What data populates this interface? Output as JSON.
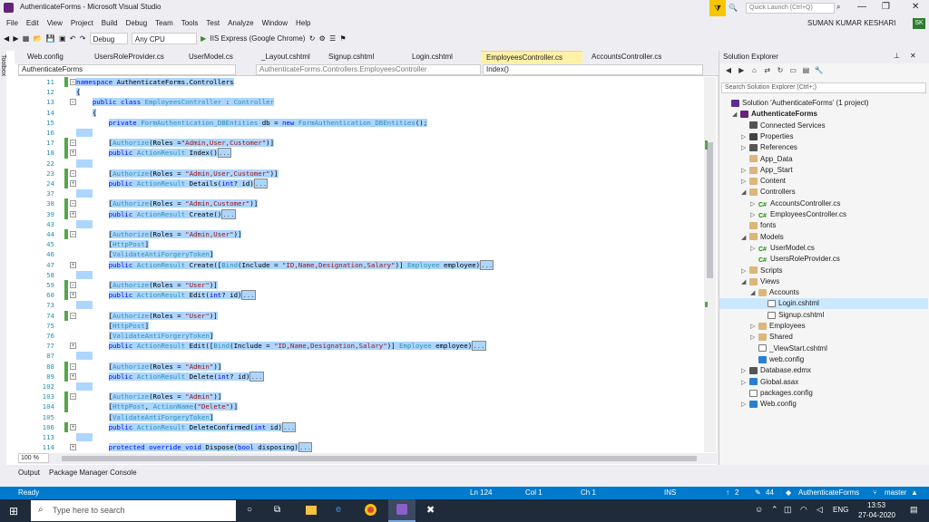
{
  "window": {
    "title": "AuthenticateForms - Microsoft Visual Studio",
    "quick_launch_placeholder": "Quick Launch (Ctrl+Q)",
    "user": "SUMAN KUMAR KESHARI",
    "user_initials": "SK"
  },
  "menu": [
    "File",
    "Edit",
    "View",
    "Project",
    "Build",
    "Debug",
    "Team",
    "Tools",
    "Test",
    "Analyze",
    "Window",
    "Help"
  ],
  "toolbar": {
    "config": "Debug",
    "platform": "Any CPU",
    "run_label": "IIS Express (Google Chrome)"
  },
  "tabs": [
    "Web.config",
    "UsersRoleProvider.cs",
    "UserModel.cs",
    "_Layout.cshtml",
    "Signup.cshtml",
    "Login.cshtml",
    "EmployeesController.cs",
    "AccountsController.cs"
  ],
  "active_tab": "EmployeesController.cs",
  "nav": {
    "project": "AuthenticateForms",
    "class": "AuthenticateForms.Controllers.EmployeesController",
    "member": "Index()"
  },
  "side_tool": "Toolbox",
  "code_lines": [
    {
      "n": "11",
      "t": "namespace AuthenticateForms.Controllers",
      "g": true
    },
    {
      "n": "12",
      "t": "{",
      "g": false
    },
    {
      "n": "13",
      "t": "    public class EmployeesController : Controller",
      "g": false
    },
    {
      "n": "14",
      "t": "    {",
      "g": false
    },
    {
      "n": "15",
      "t": "        private FormAuthentication_DBEntities db = new FormAuthentication_DBEntities();",
      "g": false
    },
    {
      "n": "16",
      "t": "",
      "g": false
    },
    {
      "n": "17",
      "t": "        [Authorize(Roles =\"Admin,User,Customer\")]",
      "g": true
    },
    {
      "n": "18",
      "t": "        public ActionResult Index()[...]",
      "g": true
    },
    {
      "n": "22",
      "t": "",
      "g": false
    },
    {
      "n": "23",
      "t": "        [Authorize(Roles = \"Admin,User,Customer\")]",
      "g": true
    },
    {
      "n": "24",
      "t": "        public ActionResult Details(int? id)[...]",
      "g": true
    },
    {
      "n": "37",
      "t": "",
      "g": false
    },
    {
      "n": "38",
      "t": "        [Authorize(Roles = \"Admin,Customer\")]",
      "g": true
    },
    {
      "n": "39",
      "t": "        public ActionResult Create()[...]",
      "g": true
    },
    {
      "n": "43",
      "t": "",
      "g": false
    },
    {
      "n": "44",
      "t": "        [Authorize(Roles = \"Admin,User\")]",
      "g": true
    },
    {
      "n": "45",
      "t": "        [HttpPost]",
      "g": false
    },
    {
      "n": "46",
      "t": "        [ValidateAntiForgeryToken]",
      "g": false
    },
    {
      "n": "47",
      "t": "        public ActionResult Create([Bind(Include = \"ID,Name,Designation,Salary\")] Employee employee)[...]",
      "g": false
    },
    {
      "n": "58",
      "t": "",
      "g": false
    },
    {
      "n": "59",
      "t": "        [Authorize(Roles = \"User\")]",
      "g": true
    },
    {
      "n": "60",
      "t": "        public ActionResult Edit(int? id)[...]",
      "g": true
    },
    {
      "n": "73",
      "t": "",
      "g": false
    },
    {
      "n": "74",
      "t": "        [Authorize(Roles = \"User\")]",
      "g": true
    },
    {
      "n": "75",
      "t": "        [HttpPost]",
      "g": false
    },
    {
      "n": "76",
      "t": "        [ValidateAntiForgeryToken]",
      "g": false
    },
    {
      "n": "77",
      "t": "        public ActionResult Edit([Bind(Include = \"ID,Name,Designation,Salary\")] Employee employee)[...]",
      "g": false
    },
    {
      "n": "87",
      "t": "",
      "g": false
    },
    {
      "n": "88",
      "t": "        [Authorize(Roles = \"Admin\")]",
      "g": true
    },
    {
      "n": "89",
      "t": "        public ActionResult Delete(int? id)[...]",
      "g": true
    },
    {
      "n": "102",
      "t": "",
      "g": false
    },
    {
      "n": "103",
      "t": "        [Authorize(Roles = \"Admin\")]",
      "g": true
    },
    {
      "n": "104",
      "t": "        [HttpPost, ActionName(\"Delete\")]",
      "g": true
    },
    {
      "n": "105",
      "t": "        [ValidateAntiForgeryToken]",
      "g": false
    },
    {
      "n": "106",
      "t": "        public ActionResult DeleteConfirmed(int id)[...]",
      "g": true
    },
    {
      "n": "113",
      "t": "",
      "g": false
    },
    {
      "n": "114",
      "t": "        protected override void Dispose(bool disposing)[...]",
      "g": false
    }
  ],
  "zoom": "100 %",
  "bottom_tabs": [
    "Output",
    "Package Manager Console"
  ],
  "status": {
    "ready": "Ready",
    "ln": "Ln 124",
    "col": "Col 1",
    "ch": "Ch 1",
    "ins": "INS",
    "up": "2",
    "edits": "44",
    "project": "AuthenticateForms",
    "branch": "master"
  },
  "solution_explorer": {
    "title": "Solution Explorer",
    "search_placeholder": "Search Solution Explorer (Ctrl+;)",
    "items": [
      {
        "label": "Solution 'AuthenticateForms' (1 project)",
        "icon": "sol",
        "depth": 0,
        "arrow": ""
      },
      {
        "label": "AuthenticateForms",
        "icon": "proj",
        "depth": 1,
        "arrow": "◢",
        "bold": true
      },
      {
        "label": "Connected Services",
        "icon": "ref",
        "depth": 2,
        "arrow": ""
      },
      {
        "label": "Properties",
        "icon": "wrench",
        "depth": 2,
        "arrow": "▷"
      },
      {
        "label": "References",
        "icon": "ref",
        "depth": 2,
        "arrow": "▷"
      },
      {
        "label": "App_Data",
        "icon": "folder",
        "depth": 2,
        "arrow": ""
      },
      {
        "label": "App_Start",
        "icon": "folder",
        "depth": 2,
        "arrow": "▷"
      },
      {
        "label": "Content",
        "icon": "folder",
        "depth": 2,
        "arrow": "▷"
      },
      {
        "label": "Controllers",
        "icon": "folder",
        "depth": 2,
        "arrow": "◢"
      },
      {
        "label": "AccountsController.cs",
        "icon": "cs",
        "depth": 3,
        "arrow": "▷"
      },
      {
        "label": "EmployeesController.cs",
        "icon": "cs",
        "depth": 3,
        "arrow": "▷"
      },
      {
        "label": "fonts",
        "icon": "folder",
        "depth": 2,
        "arrow": ""
      },
      {
        "label": "Models",
        "icon": "folder",
        "depth": 2,
        "arrow": "◢"
      },
      {
        "label": "UserModel.cs",
        "icon": "cs",
        "depth": 3,
        "arrow": "▷"
      },
      {
        "label": "UsersRoleProvider.cs",
        "icon": "cs",
        "depth": 3,
        "arrow": ""
      },
      {
        "label": "Scripts",
        "icon": "folder",
        "depth": 2,
        "arrow": "▷"
      },
      {
        "label": "Views",
        "icon": "folder",
        "depth": 2,
        "arrow": "◢"
      },
      {
        "label": "Accounts",
        "icon": "folder",
        "depth": 3,
        "arrow": "◢"
      },
      {
        "label": "Login.cshtml",
        "icon": "file",
        "depth": 4,
        "arrow": "",
        "selected": true
      },
      {
        "label": "Signup.cshtml",
        "icon": "file",
        "depth": 4,
        "arrow": ""
      },
      {
        "label": "Employees",
        "icon": "folder",
        "depth": 3,
        "arrow": "▷"
      },
      {
        "label": "Shared",
        "icon": "folder",
        "depth": 3,
        "arrow": "▷"
      },
      {
        "label": "_ViewStart.cshtml",
        "icon": "file",
        "depth": 3,
        "arrow": ""
      },
      {
        "label": "web.config",
        "icon": "web",
        "depth": 3,
        "arrow": ""
      },
      {
        "label": "Database.edmx",
        "icon": "ref",
        "depth": 2,
        "arrow": "▷"
      },
      {
        "label": "Global.asax",
        "icon": "web",
        "depth": 2,
        "arrow": "▷"
      },
      {
        "label": "packages.config",
        "icon": "file",
        "depth": 2,
        "arrow": ""
      },
      {
        "label": "Web.config",
        "icon": "web",
        "depth": 2,
        "arrow": "▷"
      }
    ]
  },
  "taskbar": {
    "search_placeholder": "Type here to search",
    "time": "13:53",
    "date": "27-04-2020",
    "lang": "ENG"
  },
  "colors": {
    "accent": "#007acc",
    "selection": "#add6ff",
    "active_tab": "#fff1a8",
    "taskbar": "#1f2a3a"
  }
}
